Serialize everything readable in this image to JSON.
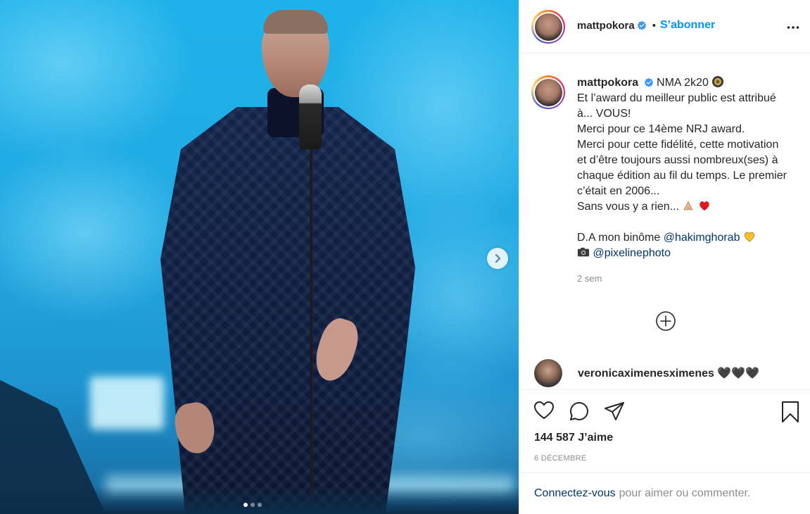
{
  "post": {
    "username": "mattpokora",
    "follow_label": "S’abonner",
    "separator": "•",
    "caption": {
      "first_line": "NMA 2k20",
      "lines": [
        "Et l’award du meilleur public est attribué à... VOUS!",
        "Merci pour ce 14ème NRJ award.",
        "Merci pour cette fidélité, cette motivation et d’être toujours aussi nombreux(ses) à chaque édition au fil du temps. Le premier c’était en 2006...",
        "Sans vous y a rien..."
      ],
      "credit_prefix": "D.A mon binôme",
      "credit_mention": "@hakimghorab",
      "photo_mention": "@pixelinephoto",
      "time_ago": "2 sem"
    },
    "comment": {
      "username": "veronicaximenesximenes",
      "text": "🖤🖤🖤"
    },
    "likes": "144 587 J’aime",
    "date": "6 DÉCEMBRE",
    "login_link": "Connectez-vous",
    "login_rest": "pour aimer ou commenter."
  },
  "carousel": {
    "current": 1,
    "total": 3
  },
  "icons": {
    "verified": "verified-badge-icon",
    "more": "more-options-icon",
    "next": "chevron-right-icon",
    "load_more": "plus-circle-icon",
    "like": "heart-icon",
    "comment": "comment-bubble-icon",
    "share": "paper-plane-icon",
    "save": "bookmark-icon"
  },
  "colors": {
    "accent": "#0095f6",
    "text": "#262626",
    "muted": "#8e8e8e",
    "link": "#00376b",
    "verified": "#3897f0"
  }
}
